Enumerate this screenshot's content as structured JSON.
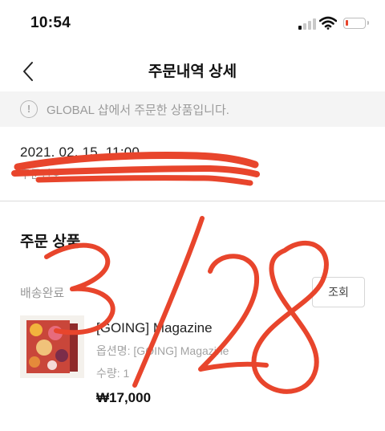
{
  "status_bar": {
    "time": "10:54",
    "icons": [
      "signal-icon",
      "wifi-icon",
      "battery-icon"
    ]
  },
  "nav": {
    "title": "주문내역 상세",
    "back_icon": "chevron-left-icon"
  },
  "notice": {
    "icon": "info-icon",
    "icon_glyph": "!",
    "text": "GLOBAL 샵에서 주문한 상품입니다."
  },
  "order": {
    "date": "2021. 02. 15. 11:00",
    "number_label": "주문번호"
  },
  "section": {
    "title": "주문 상품"
  },
  "item": {
    "delivery_status": "배송완료",
    "lookup_label": "조회",
    "name": "[GOING] Magazine",
    "option": "옵션명: [GOING] Magazine",
    "quantity": "수량: 1",
    "price": "₩17,000"
  },
  "colors": {
    "scribble": "#e8452c",
    "battery_low": "#e8452c",
    "notice_bg": "#f4f4f4",
    "muted_text": "#999999"
  }
}
